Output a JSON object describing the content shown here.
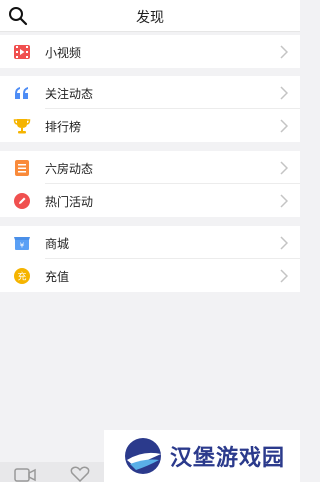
{
  "header": {
    "title": "发现",
    "search_icon": "search-icon"
  },
  "groups": [
    {
      "items": [
        {
          "label": "小视频",
          "icon": "video-icon",
          "color": "#f0504f"
        }
      ]
    },
    {
      "items": [
        {
          "label": "关注动态",
          "icon": "quote-icon",
          "color": "#4d8cf5"
        },
        {
          "label": "排行榜",
          "icon": "trophy-icon",
          "color": "#f5b400"
        }
      ]
    },
    {
      "items": [
        {
          "label": "六房动态",
          "icon": "list-icon",
          "color": "#f98a3a"
        },
        {
          "label": "热门活动",
          "icon": "pen-icon",
          "color": "#f0504f"
        }
      ]
    },
    {
      "items": [
        {
          "label": "商城",
          "icon": "shop-icon",
          "color": "#5aa0f5"
        },
        {
          "label": "充值",
          "icon": "recharge-icon",
          "color": "#f5b400"
        }
      ]
    }
  ],
  "watermark": {
    "text": "汉堡游戏园"
  }
}
